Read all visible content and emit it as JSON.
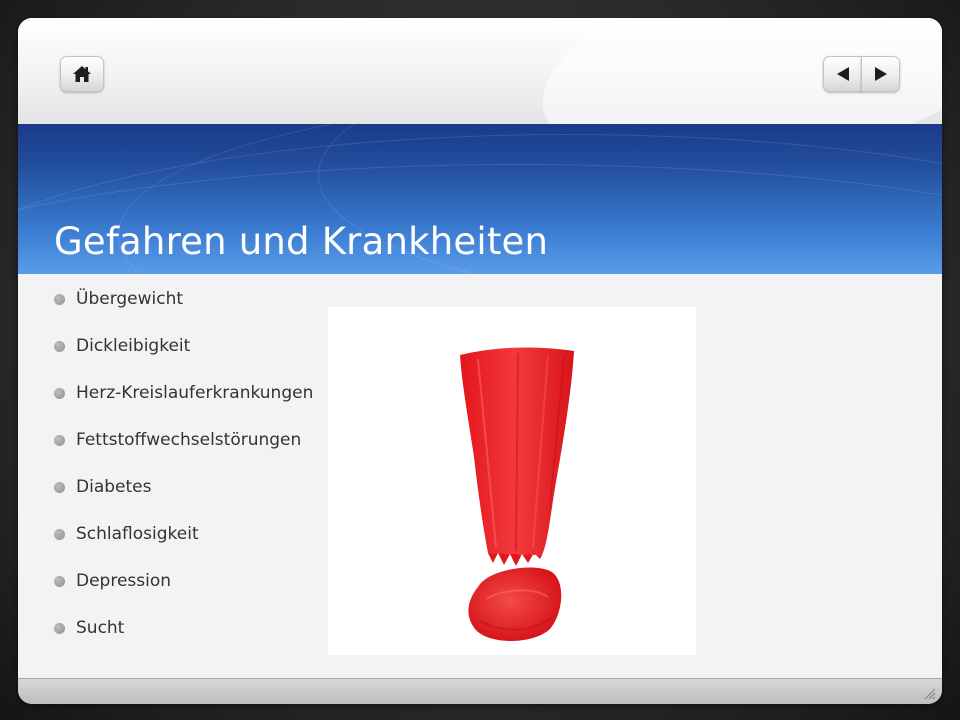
{
  "navigation": {
    "home_icon": "home-icon",
    "prev_icon": "triangle-left-icon",
    "next_icon": "triangle-right-icon"
  },
  "slide": {
    "title": "Gefahren und Krankheiten",
    "bullets": [
      "Übergewicht",
      "Dickleibigkeit",
      "Herz-Kreislauferkrankungen",
      "Fettstoffwechselstörungen",
      "Diabetes",
      "Schlaflosigkeit",
      "Depression",
      "Sucht"
    ],
    "image": "red painted exclamation mark"
  },
  "colors": {
    "title_band_dark": "#1b3a8a",
    "title_band_light": "#5b9bea",
    "exclamation_red": "#e8262b",
    "bullet_text": "#333333"
  }
}
